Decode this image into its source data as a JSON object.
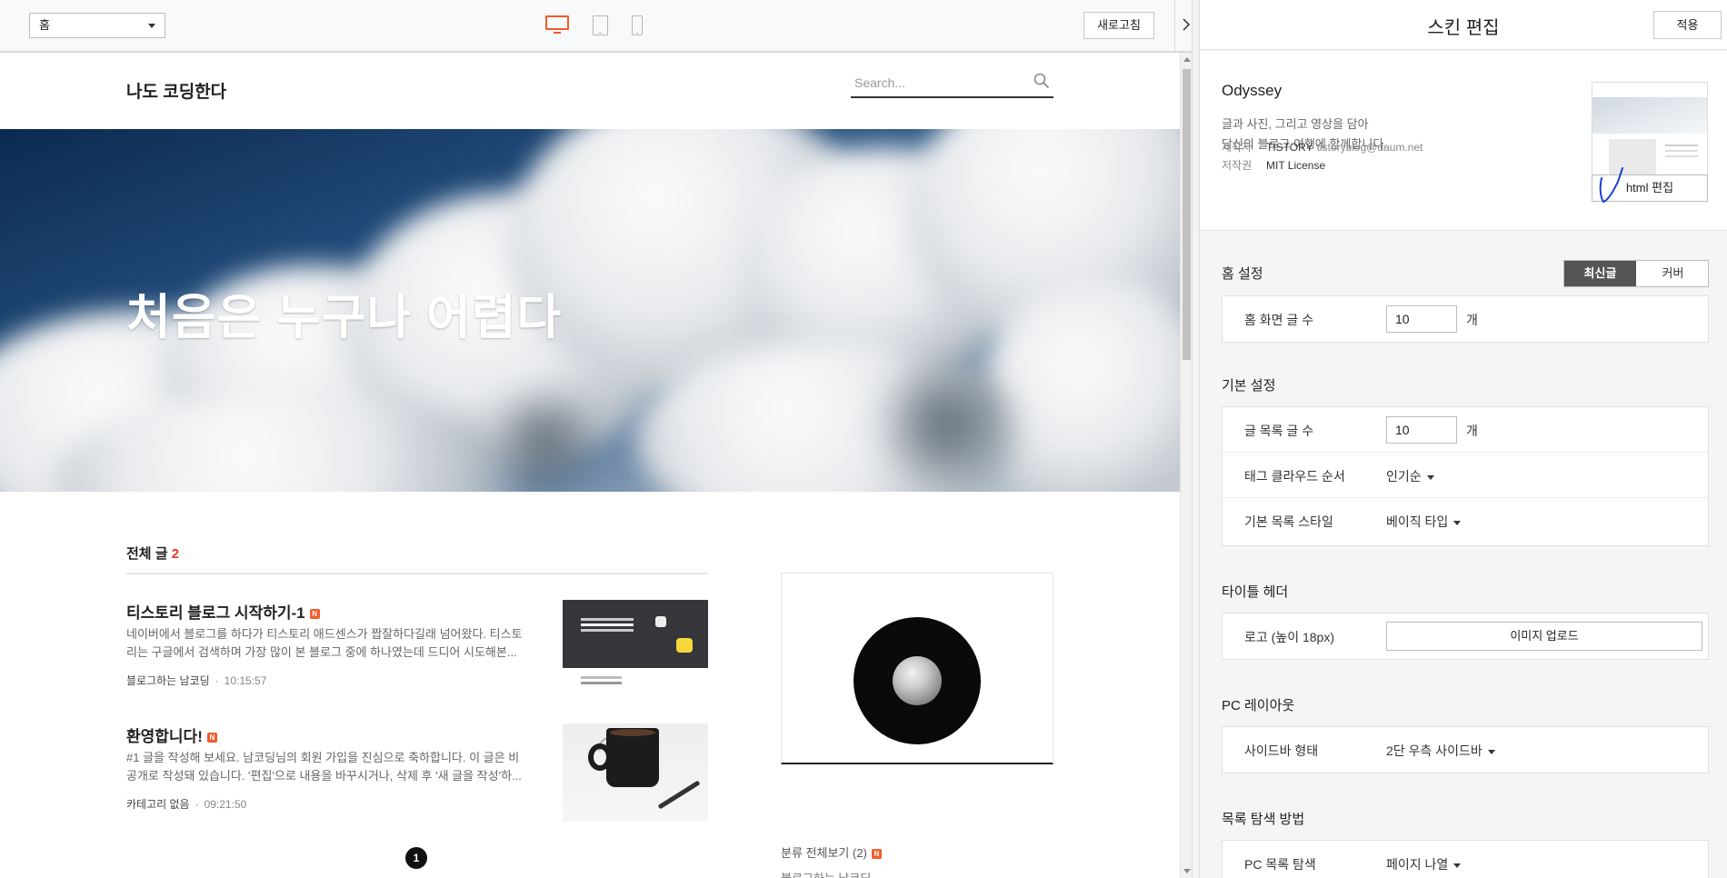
{
  "toolbar": {
    "page_select": "홈",
    "refresh_label": "새로고침"
  },
  "blog": {
    "title": "나도 코딩한다",
    "search_placeholder": "Search...",
    "hero_title": "처음은 누구나 어렵다",
    "total_label": "전체 글",
    "total_count": "2",
    "new_badge": "N",
    "posts": [
      {
        "title": "티스토리 블로그 시작하기-1",
        "excerpt": "네이버에서 블로그를 하다가 티스토리 애드센스가 짭잘하다길래 넘어왔다. 티스토리는 구글에서 검색하며 가장 많이 본 블로그 중에 하나였는데 드디어 시도해본...",
        "category": "블로그하는 남코딩",
        "time": "10:15:57"
      },
      {
        "title": "환영합니다!",
        "excerpt": "#1 글을 작성해 보세요. 남코딩님의 회원 가입을 진심으로 축하합니다. 이 글은 비공개로 작성돼 있습니다. '편집'으로 내용을 바꾸시거나, 삭제 후 '새 글을 작성'하...",
        "category": "카테고리 없음",
        "time": "09:21:50"
      }
    ],
    "pager_current": "1",
    "category_all": "분류 전체보기 (2)",
    "category_next": "블로그하는 남코딩"
  },
  "panel": {
    "title": "스킨 편집",
    "apply_label": "적용",
    "skin": {
      "name": "Odyssey",
      "desc_line1": "글과 사진, 그리고 영상을 담아",
      "desc_line2": "당신의 블로그 여행에 함께합니다.",
      "maker_key": "제작자",
      "maker_value": "TISTORY",
      "maker_email": "tistoryblog@daum.net",
      "license_key": "저작권",
      "license_value": "MIT License",
      "html_edit_label": "html 편집"
    },
    "home_settings": {
      "title": "홈 설정",
      "toggle_on": "최신글",
      "toggle_off": "커버",
      "rows": [
        {
          "label": "홈 화면 글 수",
          "value": "10",
          "unit": "개"
        }
      ]
    },
    "basic_settings": {
      "title": "기본 설정",
      "post_count_label": "글 목록 글 수",
      "post_count_value": "10",
      "post_count_unit": "개",
      "tag_order_label": "태그 클라우드 순서",
      "tag_order_value": "인기순",
      "list_style_label": "기본 목록 스타일",
      "list_style_value": "베이직 타입"
    },
    "title_header": {
      "title": "타이틀 헤더",
      "logo_label": "로고 (높이 18px)",
      "upload_label": "이미지 업로드"
    },
    "pc_layout": {
      "title": "PC 레이아웃",
      "sidebar_label": "사이드바 형태",
      "sidebar_value": "2단 우측 사이드바"
    },
    "list_nav": {
      "title": "목록 탐색 방법",
      "pc_label": "PC 목록 탐색",
      "pc_value": "페이지 나열"
    }
  },
  "colors": {
    "accent": "#f25b2a",
    "count_red": "#e03a2c",
    "toggle_active": "#555555"
  }
}
